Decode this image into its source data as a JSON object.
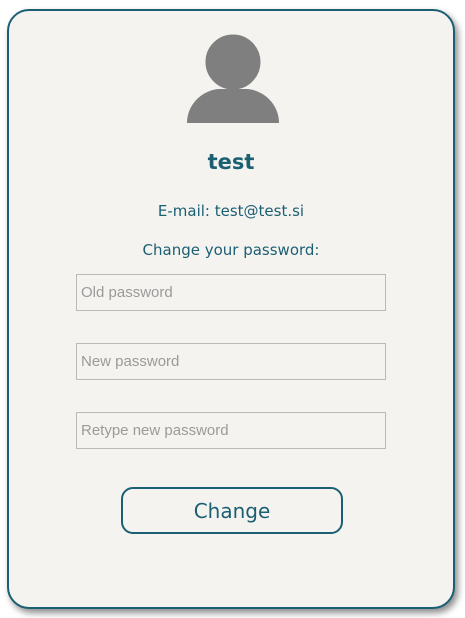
{
  "colors": {
    "accent": "#1b5f73",
    "card_background": "#f5f3ef",
    "avatar": "#7f7f7f",
    "input_border": "#b9b9b9",
    "placeholder": "#9a9a9a"
  },
  "profile": {
    "avatar_icon": "user-silhouette-icon",
    "username": "test",
    "email_line": "E-mail: test@test.si"
  },
  "password_form": {
    "heading": "Change your password:",
    "old_password_placeholder": "Old password",
    "new_password_placeholder": "New password",
    "retype_password_placeholder": "Retype new password",
    "submit_label": "Change"
  }
}
